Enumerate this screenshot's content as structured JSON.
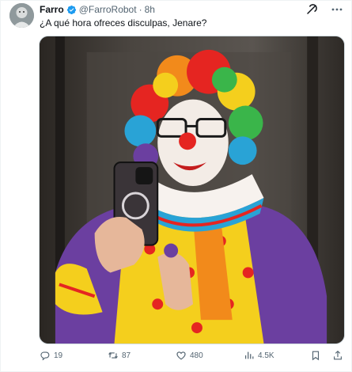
{
  "tweet": {
    "author_name": "Farro",
    "verified": true,
    "handle": "@FarroRobot",
    "separator": "·",
    "time": "8h",
    "text": "¿A qué hora ofreces disculpas, Jenare?",
    "media_description": "",
    "stats": {
      "replies": "19",
      "retweets": "87",
      "likes": "480",
      "views": "4.5K"
    }
  },
  "icons": {
    "verified": "verified-badge-icon",
    "grok": "grok-icon",
    "more": "more-icon",
    "reply": "reply-icon",
    "retweet": "retweet-icon",
    "like": "heart-icon",
    "views": "views-icon",
    "bookmark": "bookmark-icon",
    "share": "share-icon"
  },
  "colors": {
    "accent": "#1d9bf0",
    "text": "#0f1419",
    "muted": "#536471",
    "border": "#cfd9de"
  }
}
